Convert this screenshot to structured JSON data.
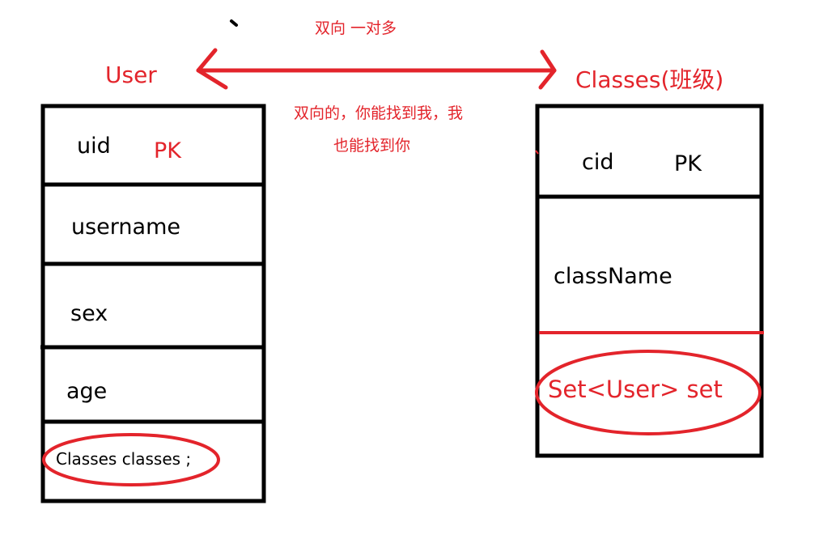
{
  "relation": {
    "title": "双向 一对多",
    "note_line1": "双向的，你能找到我，我",
    "note_line2": "也能找到你",
    "arrow": "double-headed-arrow"
  },
  "user_entity": {
    "title": "User",
    "fields": [
      {
        "name": "uid",
        "tag": "PK"
      },
      {
        "name": "username"
      },
      {
        "name": "sex"
      },
      {
        "name": "age"
      },
      {
        "name": "Classes classes ;",
        "highlighted": true
      }
    ]
  },
  "classes_entity": {
    "title": "Classes(班级)",
    "fields": [
      {
        "name": "cid",
        "tag": "PK"
      },
      {
        "name": "className"
      },
      {
        "name": "Set<User> set",
        "highlighted": true
      }
    ]
  },
  "colors": {
    "annotation_red": "#e3242b",
    "outline_black": "#000000",
    "background": "#ffffff"
  }
}
